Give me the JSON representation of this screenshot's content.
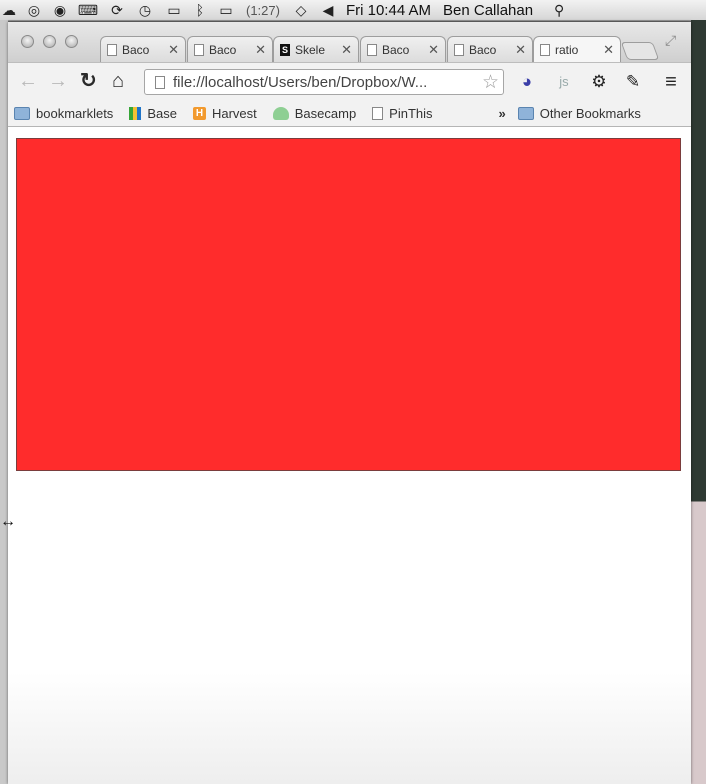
{
  "menubar": {
    "battery": "(1:27)",
    "clock": "Fri 10:44 AM",
    "user": "Ben Callahan",
    "icons": [
      "cloud-icon",
      "compass-icon",
      "keyboard-icon",
      "sync-icon",
      "time-machine-icon",
      "display-icon",
      "bluetooth-icon",
      "battery-icon",
      "wifi-icon",
      "volume-icon",
      "spotlight-icon"
    ]
  },
  "tabs": [
    {
      "label": "Baco",
      "favicon": "page"
    },
    {
      "label": "Baco",
      "favicon": "page"
    },
    {
      "label": "Skele",
      "favicon": "S"
    },
    {
      "label": "Baco",
      "favicon": "page"
    },
    {
      "label": "Baco",
      "favicon": "page"
    },
    {
      "label": "ratio",
      "favicon": "page",
      "active": true
    }
  ],
  "toolbar": {
    "url": "file://localhost/Users/ben/Dropbox/W..."
  },
  "bookmarks": [
    {
      "label": "bookmarklets",
      "icon": "folder-icon"
    },
    {
      "label": "Base",
      "icon": "base-icon"
    },
    {
      "label": "Harvest",
      "icon": "harvest-icon"
    },
    {
      "label": "Basecamp",
      "icon": "basecamp-icon"
    },
    {
      "label": "PinThis",
      "icon": "page-icon"
    }
  ],
  "other_bookmarks": "Other Bookmarks",
  "colors": {
    "red_box": "#ff2c2c"
  }
}
